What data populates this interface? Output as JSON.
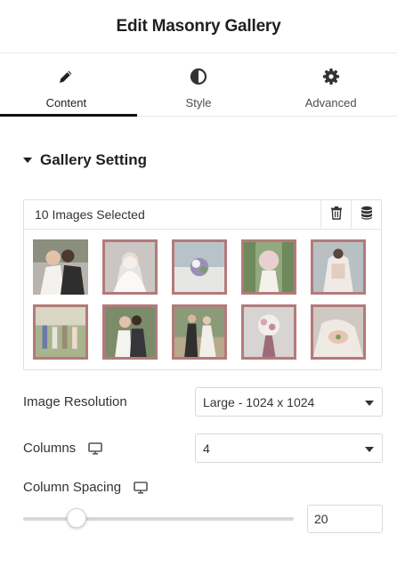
{
  "header": {
    "title": "Edit Masonry Gallery"
  },
  "tabs": [
    {
      "label": "Content",
      "icon": "pencil-icon",
      "active": true
    },
    {
      "label": "Style",
      "icon": "half-circle-icon",
      "active": false
    },
    {
      "label": "Advanced",
      "icon": "gear-icon",
      "active": false
    }
  ],
  "section": {
    "title": "Gallery Setting",
    "icon": "caret-down-icon"
  },
  "gallery": {
    "count_label": "10 Images Selected",
    "actions": [
      "trash-icon",
      "database-icon"
    ],
    "images": [
      {
        "subject": "couple-kissing",
        "selected": false
      },
      {
        "subject": "bride-veil",
        "selected": true
      },
      {
        "subject": "bride-bouquet",
        "selected": true
      },
      {
        "subject": "bride-flowers",
        "selected": true
      },
      {
        "subject": "bride-lace-back",
        "selected": true
      },
      {
        "subject": "wedding-ceremony",
        "selected": true
      },
      {
        "subject": "couple-portrait",
        "selected": true
      },
      {
        "subject": "couple-walking",
        "selected": true
      },
      {
        "subject": "bridal-bouquet",
        "selected": true
      },
      {
        "subject": "rings-hands",
        "selected": true
      }
    ]
  },
  "image_resolution": {
    "label": "Image Resolution",
    "value": "Large - 1024 x 1024"
  },
  "columns": {
    "label": "Columns",
    "value": "4",
    "icon": "monitor-icon"
  },
  "column_spacing": {
    "label": "Column Spacing",
    "value": "20",
    "icon": "monitor-icon"
  },
  "colors": {
    "accent": "#b47a7a",
    "active_tab_underline": "#111111"
  }
}
